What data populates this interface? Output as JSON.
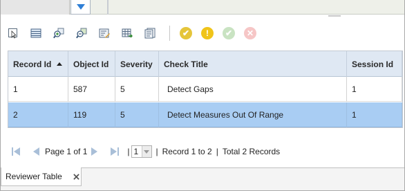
{
  "toolbar": {
    "buttons": [
      {
        "icon": "select-icon"
      },
      {
        "icon": "table-view-icon"
      },
      {
        "icon": "zoom-to-icon"
      },
      {
        "icon": "zoom-to-selected-icon"
      },
      {
        "icon": "edit-record-icon"
      },
      {
        "icon": "export-table-icon"
      },
      {
        "icon": "properties-icon"
      }
    ],
    "status_buttons": [
      {
        "icon": "accept-icon",
        "color": "#e5c53a",
        "glyph": "✔"
      },
      {
        "icon": "warning-icon",
        "color": "#f0c419",
        "glyph": "!"
      },
      {
        "icon": "resolve-icon",
        "color": "#c9e3c2",
        "glyph": "✔"
      },
      {
        "icon": "reject-icon",
        "color": "#f6c6c6",
        "glyph": "✕"
      }
    ]
  },
  "grid": {
    "columns": [
      {
        "label": "Record Id",
        "sorted": "asc"
      },
      {
        "label": "Object Id"
      },
      {
        "label": "Severity"
      },
      {
        "label": "Check Title"
      },
      {
        "label": "Session Id"
      }
    ],
    "rows": [
      {
        "record_id": "1",
        "object_id": "587",
        "severity": "5",
        "check_title": "Detect Gaps",
        "session_id": "1",
        "selected": false
      },
      {
        "record_id": "2",
        "object_id": "119",
        "severity": "5",
        "check_title": "Detect Measures Out Of Range",
        "session_id": "1",
        "selected": true
      }
    ]
  },
  "pager": {
    "page_label": "Page 1 of 1",
    "page_value": "1",
    "record_range": "Record 1 to 2",
    "total": "Total 2 Records",
    "separator": "|"
  },
  "tab": {
    "label": "Reviewer Table"
  },
  "colors": {
    "header_bg": "#dfe8f3",
    "selected_row": "#a9cdf3",
    "collapse_arrow": "#2f7fd6"
  }
}
